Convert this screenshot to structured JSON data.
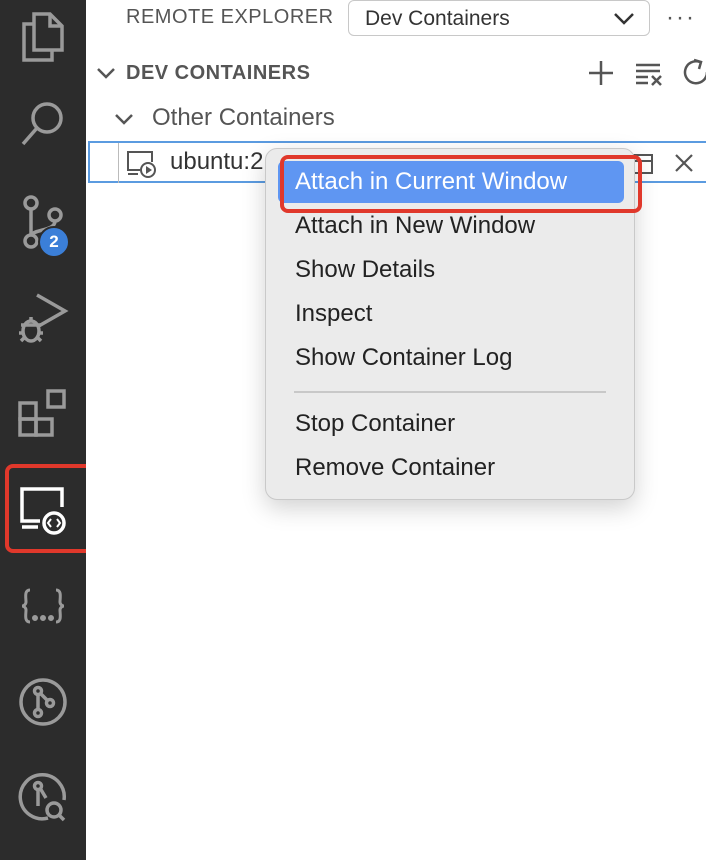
{
  "activity_bar": {
    "items": [
      {
        "icon": "files-icon"
      },
      {
        "icon": "search-icon"
      },
      {
        "icon": "source-control-icon",
        "badge": "2"
      },
      {
        "icon": "run-debug-icon"
      },
      {
        "icon": "extensions-icon"
      },
      {
        "icon": "remote-explorer-icon",
        "highlighted": true
      },
      {
        "icon": "json-braces-icon"
      },
      {
        "icon": "git-graph-icon"
      },
      {
        "icon": "git-lens-icon"
      }
    ],
    "highlight_color": "#e0382b"
  },
  "explorer": {
    "title": "REMOTE EXPLORER",
    "select_value": "Dev Containers",
    "more_label": "···"
  },
  "section": {
    "title": "DEV CONTAINERS",
    "group_label": "Other Containers",
    "item_label": "ubuntu:2"
  },
  "context_menu": {
    "items": [
      "Attach in Current Window",
      "Attach in New Window",
      "Show Details",
      "Inspect",
      "Show Container Log",
      "Stop Container",
      "Remove Container"
    ],
    "active_color": "#5f96f2"
  }
}
